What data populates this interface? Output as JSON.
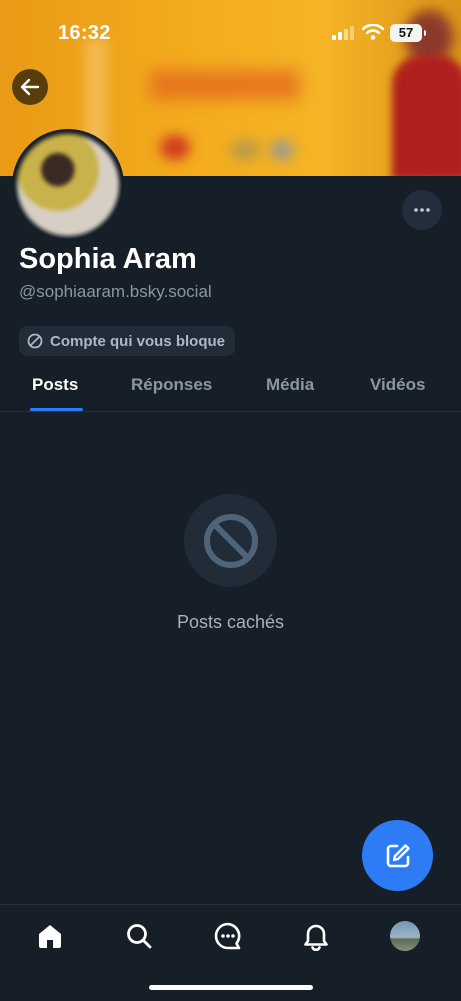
{
  "status_bar": {
    "time": "16:32",
    "battery": "57"
  },
  "profile": {
    "display_name": "Sophia Aram",
    "handle": "@sophiaaram.bsky.social",
    "block_label": "Compte qui vous bloque"
  },
  "tabs": [
    {
      "label": "Posts",
      "active": true
    },
    {
      "label": "Réponses",
      "active": false
    },
    {
      "label": "Média",
      "active": false
    },
    {
      "label": "Vidéos",
      "active": false
    }
  ],
  "empty_state": {
    "message": "Posts cachés"
  },
  "colors": {
    "background": "#161e27",
    "accent": "#2d7cf6",
    "tab_indicator": "#2a7cff"
  },
  "icons": {
    "back": "arrow-left-icon",
    "more": "ellipsis-icon",
    "blocked": "ban-icon",
    "compose": "compose-icon",
    "home": "home-icon",
    "search": "search-icon",
    "chat": "chat-icon",
    "notifications": "bell-icon"
  }
}
